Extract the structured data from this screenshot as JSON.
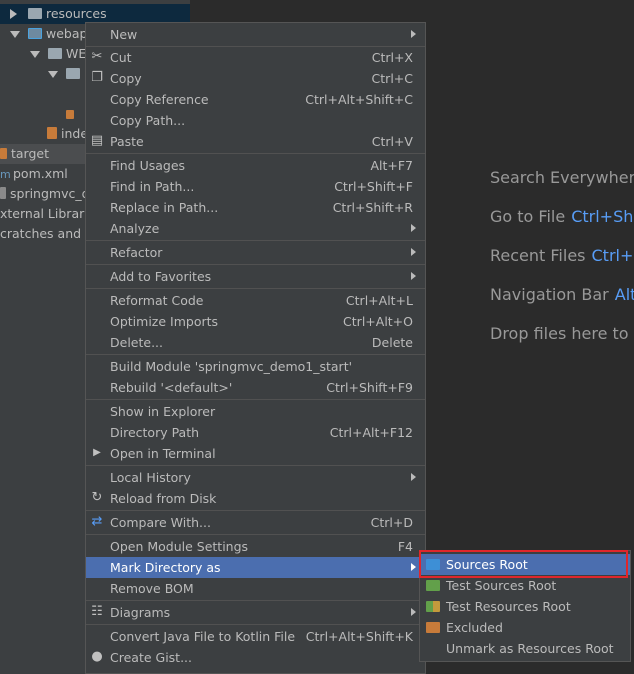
{
  "project_tree": {
    "items": [
      {
        "label": "resources"
      },
      {
        "label": "webap"
      },
      {
        "label": "WE"
      },
      {
        "label": ""
      },
      {
        "label": "inde"
      },
      {
        "label": "target"
      },
      {
        "label": "pom.xml"
      },
      {
        "label": "springmvc_d"
      },
      {
        "label": "xternal Librarie"
      },
      {
        "label": "cratches and C"
      }
    ]
  },
  "welcome": {
    "search_everywhere": "Search Everywhere",
    "goto_file": "Go to File",
    "goto_file_key": "Ctrl+Shi",
    "recent_files": "Recent Files",
    "recent_files_key": "Ctrl+E",
    "nav_bar": "Navigation Bar",
    "nav_bar_key": "Alt",
    "drop_files": "Drop files here to o"
  },
  "context_menu": {
    "items": [
      {
        "label": "New",
        "shortcut": ""
      },
      {
        "label": "Cut",
        "shortcut": "Ctrl+X"
      },
      {
        "label": "Copy",
        "shortcut": "Ctrl+C"
      },
      {
        "label": "Copy Reference",
        "shortcut": "Ctrl+Alt+Shift+C"
      },
      {
        "label": "Copy Path...",
        "shortcut": ""
      },
      {
        "label": "Paste",
        "shortcut": "Ctrl+V"
      },
      {
        "label": "Find Usages",
        "shortcut": "Alt+F7"
      },
      {
        "label": "Find in Path...",
        "shortcut": "Ctrl+Shift+F"
      },
      {
        "label": "Replace in Path...",
        "shortcut": "Ctrl+Shift+R"
      },
      {
        "label": "Analyze",
        "shortcut": ""
      },
      {
        "label": "Refactor",
        "shortcut": ""
      },
      {
        "label": "Add to Favorites",
        "shortcut": ""
      },
      {
        "label": "Reformat Code",
        "shortcut": "Ctrl+Alt+L"
      },
      {
        "label": "Optimize Imports",
        "shortcut": "Ctrl+Alt+O"
      },
      {
        "label": "Delete...",
        "shortcut": "Delete"
      },
      {
        "label": "Build Module 'springmvc_demo1_start'",
        "shortcut": ""
      },
      {
        "label": "Rebuild '<default>'",
        "shortcut": "Ctrl+Shift+F9"
      },
      {
        "label": "Show in Explorer",
        "shortcut": ""
      },
      {
        "label": "Directory Path",
        "shortcut": "Ctrl+Alt+F12"
      },
      {
        "label": "Open in Terminal",
        "shortcut": ""
      },
      {
        "label": "Local History",
        "shortcut": ""
      },
      {
        "label": "Reload from Disk",
        "shortcut": ""
      },
      {
        "label": "Compare With...",
        "shortcut": "Ctrl+D"
      },
      {
        "label": "Open Module Settings",
        "shortcut": "F4"
      },
      {
        "label": "Mark Directory as",
        "shortcut": ""
      },
      {
        "label": "Remove BOM",
        "shortcut": ""
      },
      {
        "label": "Diagrams",
        "shortcut": ""
      },
      {
        "label": "Convert Java File to Kotlin File",
        "shortcut": "Ctrl+Alt+Shift+K"
      },
      {
        "label": "Create Gist...",
        "shortcut": ""
      }
    ]
  },
  "mark_directory_submenu": {
    "items": [
      {
        "label": "Sources Root",
        "color": "#3d8fd6"
      },
      {
        "label": "Test Sources Root",
        "color": "#62a04a"
      },
      {
        "label": "Test Resources Root",
        "color": "#c49a3c"
      },
      {
        "label": "Excluded",
        "color": "#c77b3a"
      },
      {
        "label": "Unmark as Resources Root",
        "color": ""
      }
    ]
  },
  "colors": {
    "menu_bg": "#3c3f41",
    "selection": "#4b6eaf",
    "highlight_box": "#e0262b",
    "shortcut_blue": "#589df6"
  }
}
